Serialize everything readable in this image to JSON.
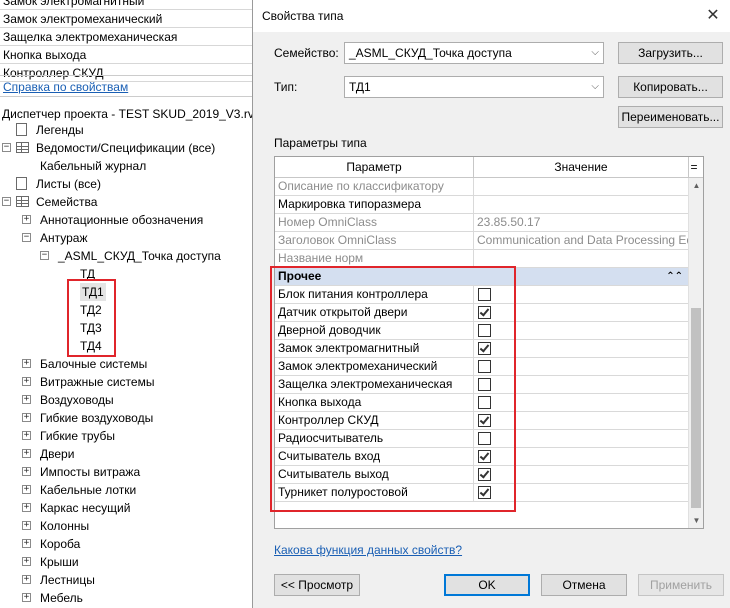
{
  "left_panel": {
    "properties": [
      "Замок электромагнитный",
      "Замок электромеханический",
      "Защелка электромеханическая",
      "Кнопка выхода",
      "Контроллер СКУД"
    ],
    "help_link": "Справка по свойствам",
    "project_browser_title": "Диспетчер проекта - TEST SKUD_2019_V3.rvt",
    "tree": [
      {
        "label": "Легенды",
        "level": 0,
        "expander": "",
        "icon": "sheet"
      },
      {
        "label": "Ведомости/Спецификации (все)",
        "level": 0,
        "expander": "−",
        "icon": "grid"
      },
      {
        "label": "Кабельный журнал",
        "level": 1,
        "expander": "",
        "icon": ""
      },
      {
        "label": "Листы (все)",
        "level": 0,
        "expander": "",
        "icon": "sheet"
      },
      {
        "label": "Семейства",
        "level": 0,
        "expander": "−",
        "icon": "grid"
      },
      {
        "label": "Аннотационные обозначения",
        "level": 1,
        "expander": "+",
        "icon": ""
      },
      {
        "label": "Антураж",
        "level": 1,
        "expander": "−",
        "icon": ""
      },
      {
        "label": "_ASML_СКУД_Точка доступа",
        "level": 2,
        "expander": "−",
        "icon": ""
      },
      {
        "label": "ТД",
        "level": 3,
        "expander": "",
        "icon": ""
      },
      {
        "label": "ТД1",
        "level": 3,
        "expander": "",
        "icon": "",
        "selected": true
      },
      {
        "label": "ТД2",
        "level": 3,
        "expander": "",
        "icon": ""
      },
      {
        "label": "ТД3",
        "level": 3,
        "expander": "",
        "icon": ""
      },
      {
        "label": "ТД4",
        "level": 3,
        "expander": "",
        "icon": ""
      },
      {
        "label": "Балочные системы",
        "level": 1,
        "expander": "+",
        "icon": ""
      },
      {
        "label": "Витражные системы",
        "level": 1,
        "expander": "+",
        "icon": ""
      },
      {
        "label": "Воздуховоды",
        "level": 1,
        "expander": "+",
        "icon": ""
      },
      {
        "label": "Гибкие воздуховоды",
        "level": 1,
        "expander": "+",
        "icon": ""
      },
      {
        "label": "Гибкие трубы",
        "level": 1,
        "expander": "+",
        "icon": ""
      },
      {
        "label": "Двери",
        "level": 1,
        "expander": "+",
        "icon": ""
      },
      {
        "label": "Импосты витража",
        "level": 1,
        "expander": "+",
        "icon": ""
      },
      {
        "label": "Кабельные лотки",
        "level": 1,
        "expander": "+",
        "icon": ""
      },
      {
        "label": "Каркас несущий",
        "level": 1,
        "expander": "+",
        "icon": ""
      },
      {
        "label": "Колонны",
        "level": 1,
        "expander": "+",
        "icon": ""
      },
      {
        "label": "Короба",
        "level": 1,
        "expander": "+",
        "icon": ""
      },
      {
        "label": "Крыши",
        "level": 1,
        "expander": "+",
        "icon": ""
      },
      {
        "label": "Лестницы",
        "level": 1,
        "expander": "+",
        "icon": ""
      },
      {
        "label": "Мебель",
        "level": 1,
        "expander": "+",
        "icon": ""
      }
    ]
  },
  "dialog": {
    "title": "Свойства типа",
    "family_label": "Семейство:",
    "family_value": "_ASML_СКУД_Точка доступа",
    "type_label": "Тип:",
    "type_value": "ТД1",
    "load_button": "Загрузить...",
    "duplicate_button": "Копировать...",
    "rename_button": "Переименовать...",
    "params_label": "Параметры типа",
    "columns": [
      "Параметр",
      "Значение",
      "="
    ],
    "rows": [
      {
        "kind": "text",
        "name": "Описание по классификатору",
        "value": "",
        "grey": true
      },
      {
        "kind": "text",
        "name": "Маркировка типоразмера",
        "value": "",
        "grey": false
      },
      {
        "kind": "text",
        "name": "Номер OmniClass",
        "value": "23.85.50.17",
        "grey": true
      },
      {
        "kind": "text",
        "name": "Заголовок OmniClass",
        "value": "Communication and Data Processing Eq",
        "grey": true
      },
      {
        "kind": "text",
        "name": "Название норм",
        "value": "",
        "grey": true
      },
      {
        "kind": "group",
        "name": "Прочее",
        "chevron": "⌃⌃"
      },
      {
        "kind": "check",
        "name": "Блок питания контроллера",
        "checked": false
      },
      {
        "kind": "check",
        "name": "Датчик открытой двери",
        "checked": true
      },
      {
        "kind": "check",
        "name": "Дверной доводчик",
        "checked": false
      },
      {
        "kind": "check",
        "name": "Замок электромагнитный",
        "checked": true
      },
      {
        "kind": "check",
        "name": "Замок электромеханический",
        "checked": false
      },
      {
        "kind": "check",
        "name": "Защелка электромеханическая",
        "checked": false
      },
      {
        "kind": "check",
        "name": "Кнопка выхода",
        "checked": false
      },
      {
        "kind": "check",
        "name": "Контроллер СКУД",
        "checked": true
      },
      {
        "kind": "check",
        "name": "Радиосчитыватель",
        "checked": false
      },
      {
        "kind": "check",
        "name": "Считыватель вход",
        "checked": true
      },
      {
        "kind": "check",
        "name": "Считыватель выход",
        "checked": true
      },
      {
        "kind": "check",
        "name": "Турникет полуростовой",
        "checked": true
      }
    ],
    "help_link": "Какова функция данных свойств?",
    "preview_button": "<< Просмотр",
    "ok_button": "OK",
    "cancel_button": "Отмена",
    "apply_button": "Применить"
  },
  "colors": {
    "highlight_border": "#e0252b",
    "group_background": "#d4dff0",
    "link": "#1a5fb4",
    "default_button_border": "#0078d7"
  }
}
